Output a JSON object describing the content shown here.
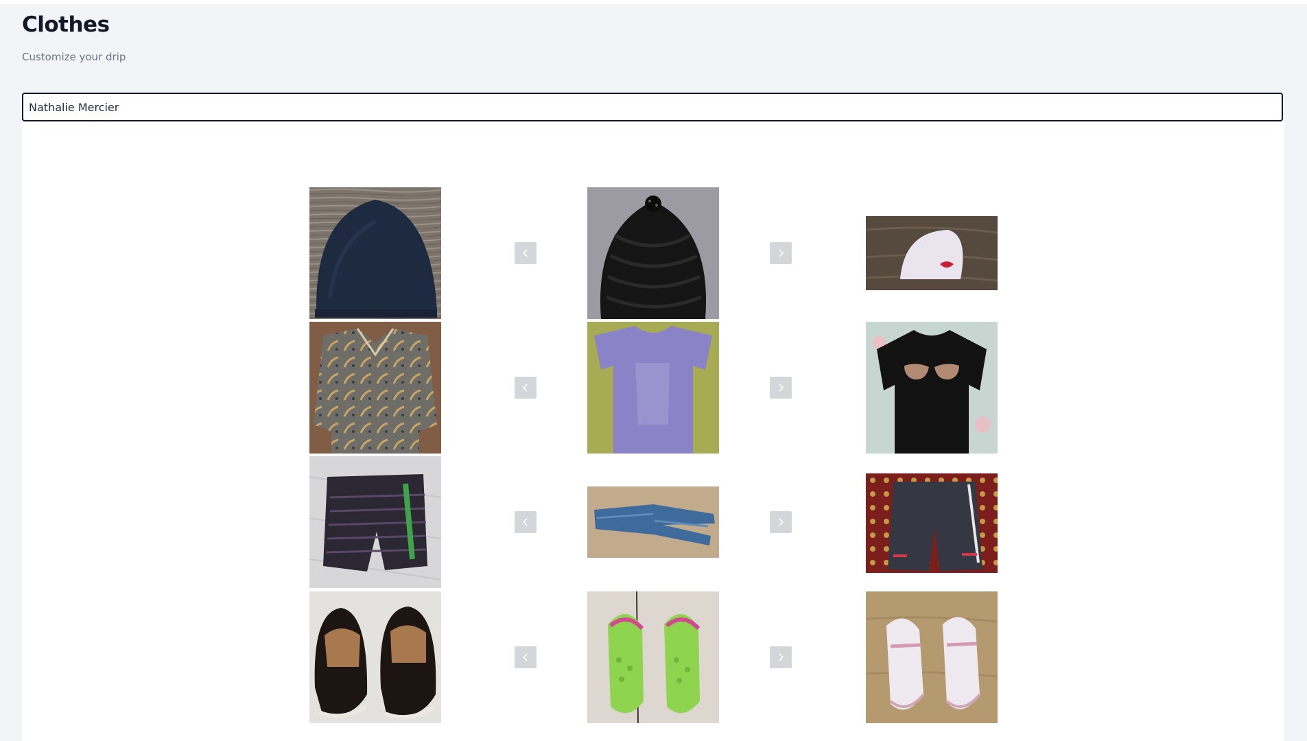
{
  "header": {
    "title": "Clothes",
    "subtitle": "Customize your drip"
  },
  "name_input": {
    "value": "Nathalie Mercier"
  },
  "outfit_rows": [
    {
      "category": "hat",
      "left_item": "navy beanie",
      "center_item": "black knit beanie",
      "right_item": "white beanie with red lips"
    },
    {
      "category": "top",
      "left_item": "patterned button-up shirt",
      "center_item": "lavender t-shirt",
      "right_item": "black t-shirt with sunglasses print"
    },
    {
      "category": "bottom",
      "left_item": "striped swim shorts",
      "center_item": "blue jeans",
      "right_item": "grey shorts"
    },
    {
      "category": "shoes",
      "left_item": "black slip-on shoes",
      "center_item": "green clogs",
      "right_item": "pink slippers"
    }
  ],
  "nav": {
    "prev_icon": "chevron-left-icon",
    "next_icon": "chevron-right-icon"
  },
  "colors": {
    "background": "#f3f4f8",
    "title": "#121826",
    "subtitle": "#6b7280",
    "nav_button": "#d4d6da"
  }
}
